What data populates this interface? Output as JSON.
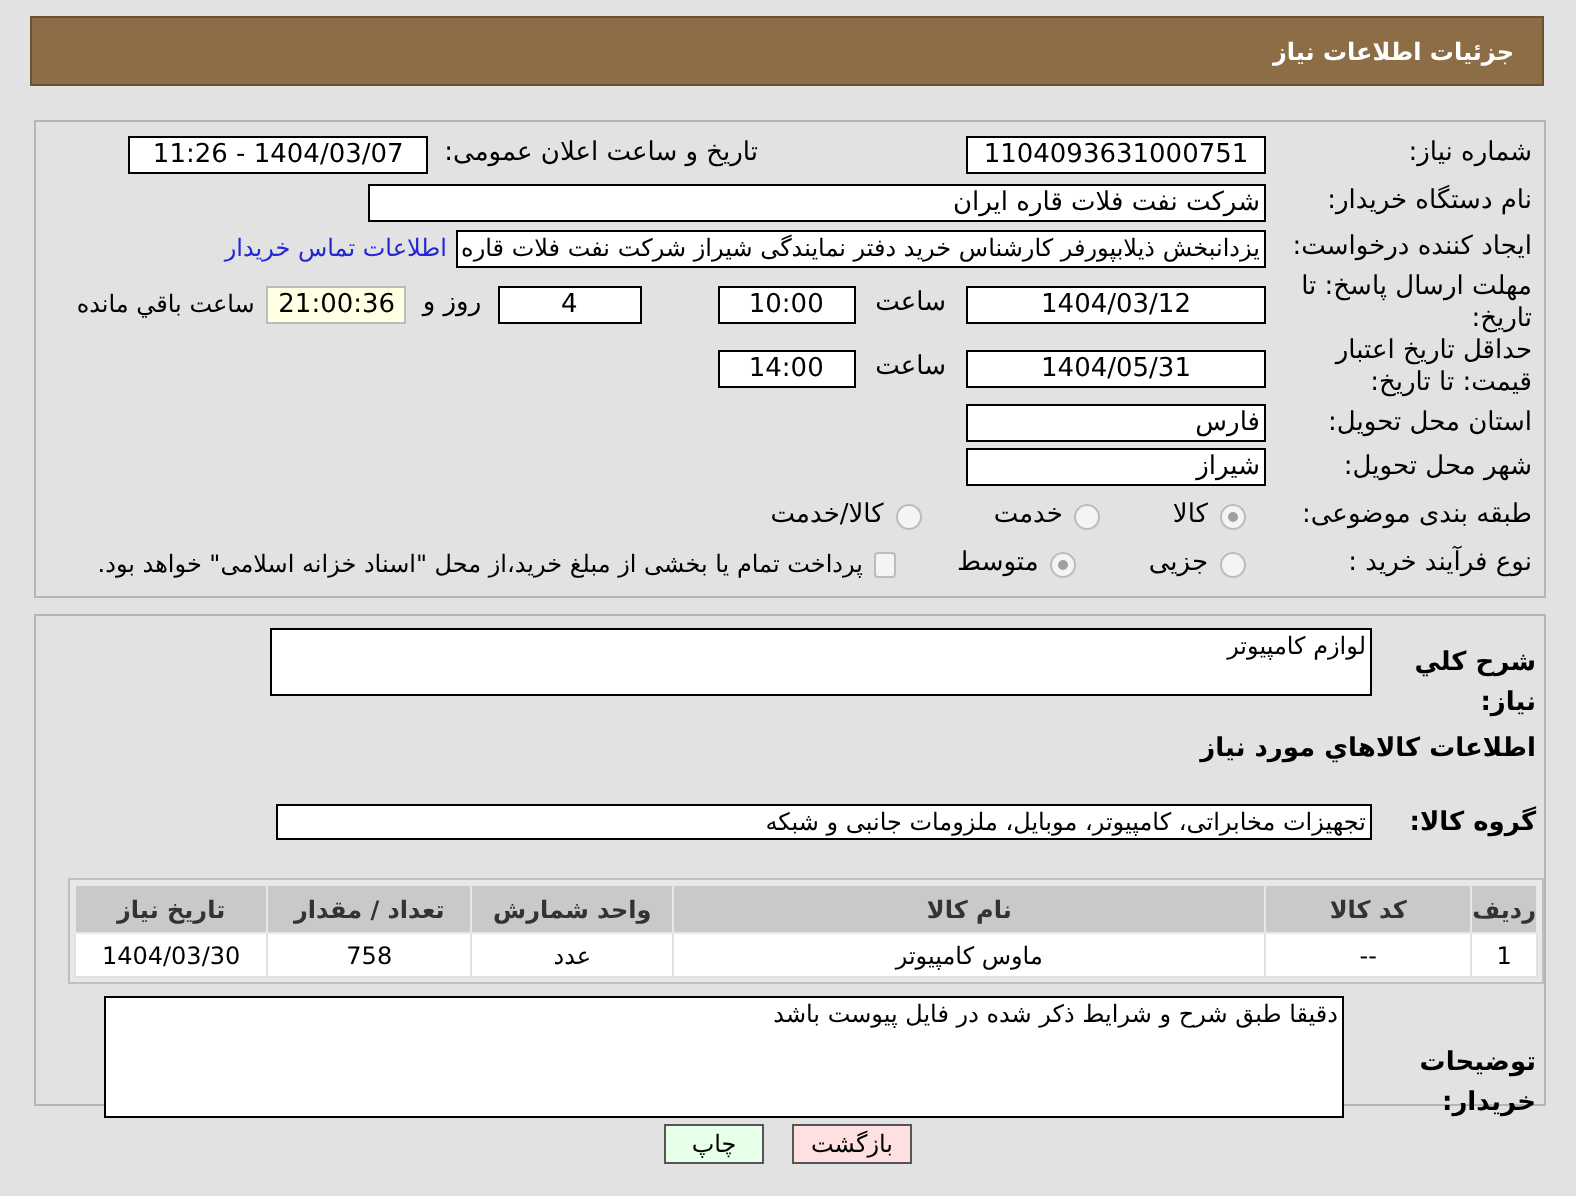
{
  "header": {
    "title": "جزئیات اطلاعات نیاز"
  },
  "need_number": {
    "label": "شماره نیاز:",
    "value": "1104093631000751"
  },
  "announce": {
    "label": "تاریخ و ساعت اعلان عمومی:",
    "value": "1404/03/07 - 11:26"
  },
  "buyer": {
    "label": "نام دستگاه خریدار:",
    "value": "شرکت نفت فلات قاره ایران"
  },
  "creator": {
    "label": "ایجاد کننده درخواست:",
    "value": "یزدانبخش ذیلابپورفر کارشناس خرید دفتر نمایندگی شیراز شرکت نفت فلات قاره",
    "link": "اطلاعات تماس خریدار"
  },
  "deadline": {
    "label": "مهلت ارسال پاسخ: تا تاریخ:",
    "date": "1404/03/12",
    "time_label": "ساعت",
    "time": "10:00",
    "days": "4",
    "days_label": "روز و",
    "remaining": "21:00:36",
    "remaining_label": "ساعت باقي مانده"
  },
  "validity": {
    "label": "حداقل تاریخ اعتبار قیمت: تا تاریخ:",
    "date": "1404/05/31",
    "time_label": "ساعت",
    "time": "14:00"
  },
  "province": {
    "label": "استان محل تحویل:",
    "value": "فارس"
  },
  "city": {
    "label": "شهر محل تحویل:",
    "value": "شیراز"
  },
  "category": {
    "label": "طبقه بندی موضوعی:",
    "options": [
      {
        "label": "کالا",
        "selected": true
      },
      {
        "label": "خدمت",
        "selected": false
      },
      {
        "label": "کالا/خدمت",
        "selected": false
      }
    ]
  },
  "process": {
    "label": "نوع فرآیند خرید :",
    "options": [
      {
        "label": "جزیی",
        "selected": false
      },
      {
        "label": "متوسط",
        "selected": true
      }
    ],
    "payment": {
      "label": "پرداخت تمام یا بخشی از مبلغ خرید،از محل \"اسناد خزانه اسلامی\" خواهد بود.",
      "checked": false
    }
  },
  "description": {
    "label": "شرح کلي نياز:",
    "value": "لوازم کامپیوتر"
  },
  "goods_heading": "اطلاعات کالاهاي مورد نياز",
  "goods_group": {
    "label": "گروه کالا:",
    "value": "تجهیزات مخابراتی، کامپیوتر، موبایل، ملزومات جانبی و شبکه"
  },
  "table": {
    "columns": [
      "ردیف",
      "کد کالا",
      "نام کالا",
      "واحد شمارش",
      "تعداد / مقدار",
      "تاریخ نیاز"
    ],
    "rows": [
      [
        "1",
        "--",
        "ماوس کامپیوتر",
        "عدد",
        "758",
        "1404/03/30"
      ]
    ]
  },
  "buyer_notes": {
    "label": "توضیحات خریدار:",
    "value": "دقیقا طبق شرح و شرایط ذکر شده در فایل پیوست باشد"
  },
  "buttons": [
    {
      "label": "بازگشت",
      "kind": "back"
    },
    {
      "label": "چاپ",
      "kind": "print"
    }
  ]
}
